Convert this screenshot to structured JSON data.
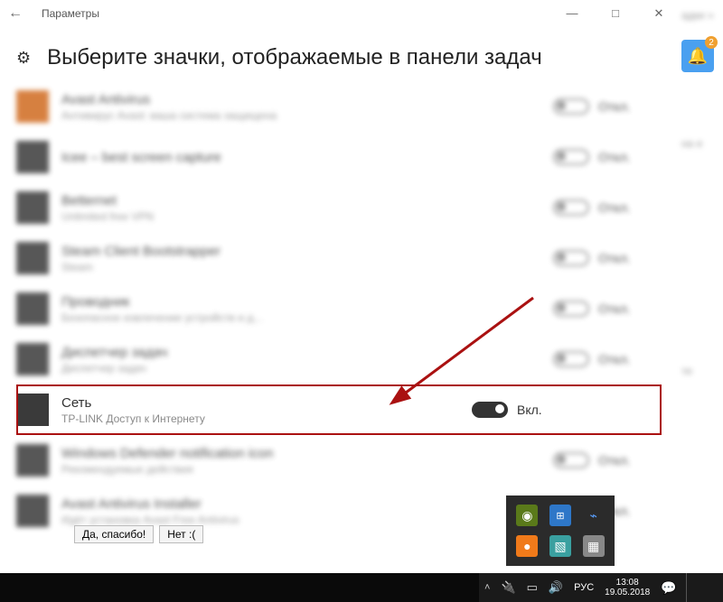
{
  "window": {
    "title": "Параметры",
    "min": "—",
    "max": "□",
    "close": "✕",
    "back": "←"
  },
  "header": {
    "gear": "⚙",
    "title": "Выберите значки, отображаемые в панели задач"
  },
  "rows": [
    {
      "name": "Avast Antivirus",
      "sub": "Антивирус Avast: ваша система защищена",
      "state": "Откл.",
      "on": false,
      "ico": "or",
      "blur": true
    },
    {
      "name": "Icee – best screen capture",
      "sub": "",
      "state": "Откл.",
      "on": false,
      "ico": "",
      "blur": true
    },
    {
      "name": "Betternet",
      "sub": "Unlimited free VPN",
      "state": "Откл.",
      "on": false,
      "ico": "",
      "blur": true
    },
    {
      "name": "Steam Client Bootstrapper",
      "sub": "Steam",
      "state": "Откл.",
      "on": false,
      "ico": "",
      "blur": true
    },
    {
      "name": "Проводник",
      "sub": "Безопасное извлечение устройств и д...",
      "state": "Откл.",
      "on": false,
      "ico": "",
      "blur": true
    },
    {
      "name": "Диспетчер задач",
      "sub": "Диспетчер задач",
      "state": "Откл.",
      "on": false,
      "ico": "",
      "blur": true
    },
    {
      "name": "Сеть",
      "sub": "TP-LINK Доступ к Интернету",
      "state": "Вкл.",
      "on": true,
      "ico": "",
      "blur": false,
      "focus": true
    },
    {
      "name": "Windows Defender notification icon",
      "sub": "Рекомендуемые действия",
      "state": "Откл.",
      "on": false,
      "ico": "",
      "blur": true
    },
    {
      "name": "Avast Antivirus Installer",
      "sub": "Идёт установка Avast Free Antivirus",
      "state": "Откл.",
      "on": false,
      "ico": "",
      "blur": true
    }
  ],
  "dialog": {
    "yes": "Да, спасибо!",
    "no": "Нет :("
  },
  "bell_badge": "2",
  "taskbar": {
    "lang": "РУС",
    "time": "13:08",
    "date": "19.05.2018"
  },
  "rside_text": [
    "адки »",
    "на е",
    "те"
  ]
}
